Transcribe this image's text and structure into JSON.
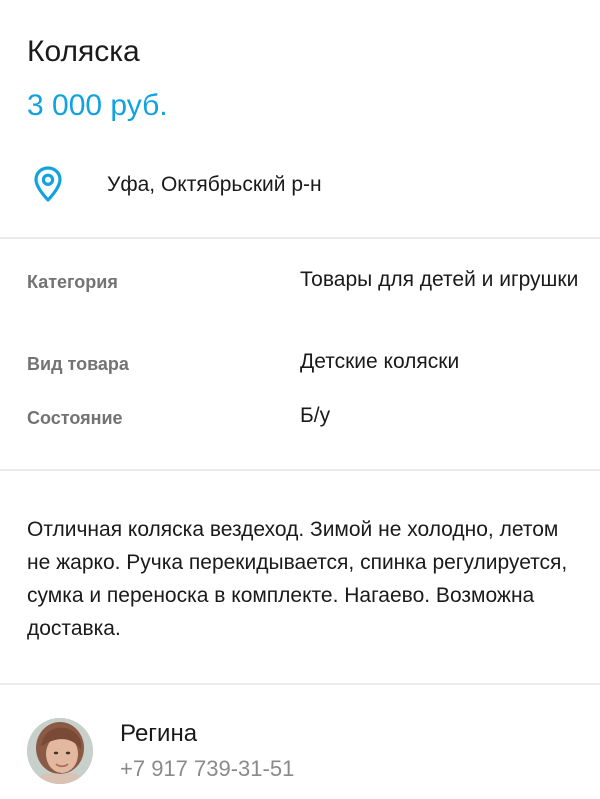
{
  "listing": {
    "title": "Коляска",
    "price": "3 000 руб.",
    "location": "Уфа, Октябрьский р-н"
  },
  "attributes": [
    {
      "label": "Категория",
      "value": "Товары для детей и игрушки"
    },
    {
      "label": "Вид товара",
      "value": "Детские коляски"
    },
    {
      "label": "Состояние",
      "value": "Б/у"
    }
  ],
  "description": "Отличная коляска вездеход. Зимой не холодно, летом не жарко. Ручка перекидывается, спинка регулируется, сумка и переноска в комплекте. Нагаево. Возможна доставка.",
  "seller": {
    "name": "Регина",
    "phone": "+7 917 739-31-51"
  },
  "icons": {
    "location": "map-pin-icon"
  },
  "colors": {
    "accent": "#11a3e0",
    "text": "#1a1a1a",
    "muted": "#737373",
    "divider": "#ebebeb"
  }
}
